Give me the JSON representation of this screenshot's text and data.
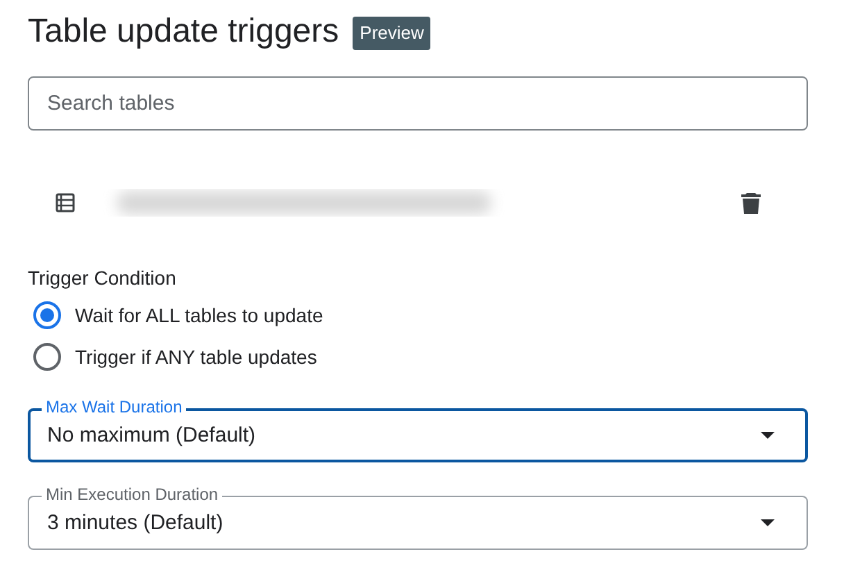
{
  "title": "Table update triggers",
  "badge": "Preview",
  "search": {
    "placeholder": "Search tables"
  },
  "trigger_condition": {
    "label": "Trigger Condition",
    "options": [
      {
        "label": "Wait for ALL tables to update",
        "selected": true
      },
      {
        "label": "Trigger if ANY table updates",
        "selected": false
      }
    ]
  },
  "selects": [
    {
      "label": "Max Wait Duration",
      "value": "No maximum (Default)",
      "focused": true
    },
    {
      "label": "Min Execution Duration",
      "value": "3 minutes (Default)",
      "focused": false
    }
  ]
}
